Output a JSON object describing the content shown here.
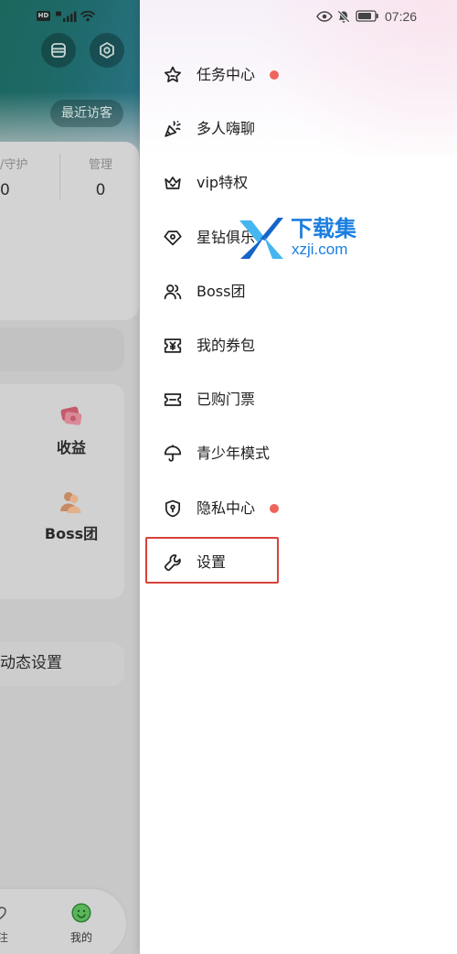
{
  "background_page": {
    "status_bar": {
      "hd_badge": "HD",
      "icons": [
        "signal-icon",
        "wifi-icon"
      ]
    },
    "header": {
      "menu_button_icon": "menu-icon",
      "settings_button_icon": "hexagon-gear-icon",
      "recent_visitors_label": "最近访客"
    },
    "stats": [
      {
        "label": "/守护",
        "value": "0"
      },
      {
        "label": "管理",
        "value": "0"
      }
    ],
    "grid_items": [
      {
        "label": "收益",
        "icon": "revenue-icon"
      },
      {
        "label": "Boss团",
        "icon": "boss-group-avatar-icon"
      }
    ],
    "dynamic_settings_label": "动态设置",
    "bottom_nav": [
      {
        "label": "注",
        "icon": "heart-icon",
        "active": false
      },
      {
        "label": "我的",
        "icon": "smiley-icon",
        "active": true
      }
    ]
  },
  "drawer": {
    "status_bar": {
      "time": "07:26",
      "icons": [
        "eye-icon",
        "muted-bell-icon",
        "battery-icon"
      ]
    },
    "menu_items": [
      {
        "label": "任务中心",
        "icon": "star-icon",
        "badge_dot": true,
        "highlighted": false
      },
      {
        "label": "多人嗨聊",
        "icon": "party-popper-icon",
        "badge_dot": false,
        "highlighted": false
      },
      {
        "label": "vip特权",
        "icon": "crown-icon",
        "badge_dot": false,
        "highlighted": false
      },
      {
        "label": "星钻俱乐",
        "icon": "diamond-icon",
        "badge_dot": false,
        "highlighted": false
      },
      {
        "label": "Boss团",
        "icon": "group-icon",
        "badge_dot": false,
        "highlighted": false
      },
      {
        "label": "我的券包",
        "icon": "coupon-icon",
        "badge_dot": false,
        "highlighted": false
      },
      {
        "label": "已购门票",
        "icon": "ticket-icon",
        "badge_dot": false,
        "highlighted": false
      },
      {
        "label": "青少年模式",
        "icon": "umbrella-icon",
        "badge_dot": false,
        "highlighted": false
      },
      {
        "label": "隐私中心",
        "icon": "shield-icon",
        "badge_dot": true,
        "highlighted": false
      },
      {
        "label": "设置",
        "icon": "wrench-icon",
        "badge_dot": false,
        "highlighted": true
      }
    ]
  },
  "watermark": {
    "brand": "下载集",
    "domain": "xzji.com",
    "icon": "xzji-logo-icon"
  },
  "colors": {
    "badge_dot": "#f0645c",
    "highlight_border": "#d8413b",
    "watermark_blue": "#1b7fe0",
    "active_nav_green": "#59b65a"
  }
}
